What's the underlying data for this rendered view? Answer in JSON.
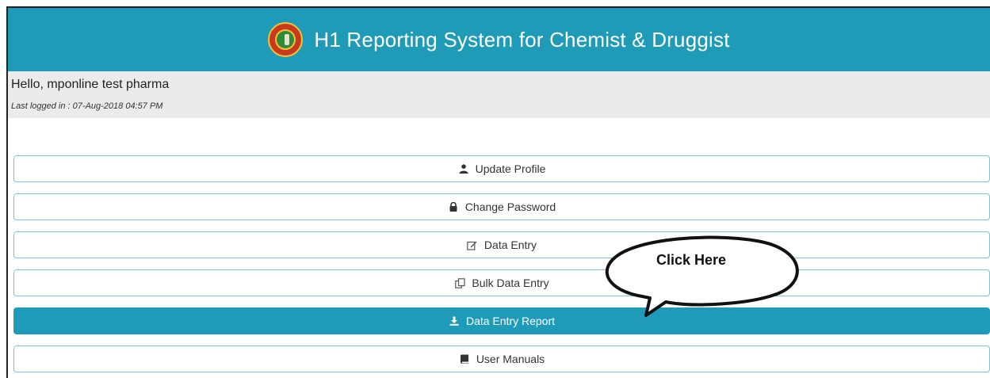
{
  "header": {
    "title": "H1 Reporting System for Chemist & Druggist"
  },
  "user": {
    "greeting": "Hello, mponline test pharma",
    "last_login": "Last logged in : 07-Aug-2018 04:57 PM"
  },
  "menu": {
    "items": [
      {
        "label": "Update Profile",
        "icon": "user-icon",
        "active": false
      },
      {
        "label": "Change Password",
        "icon": "lock-icon",
        "active": false
      },
      {
        "label": "Data Entry",
        "icon": "edit-icon",
        "active": false
      },
      {
        "label": "Bulk Data Entry",
        "icon": "copy-icon",
        "active": false
      },
      {
        "label": "Data Entry Report",
        "icon": "download-icon",
        "active": true
      },
      {
        "label": "User Manuals",
        "icon": "book-icon",
        "active": false
      }
    ]
  },
  "annotation": {
    "callout_text": "Click Here"
  },
  "colors": {
    "accent": "#1f9bb8",
    "greet_bg": "#ebebeb",
    "border": "#7fc3d3"
  }
}
